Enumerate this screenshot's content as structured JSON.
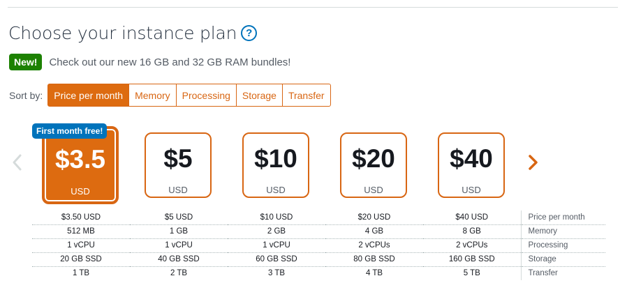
{
  "header": {
    "title": "Choose your instance plan",
    "help_icon": "?"
  },
  "promo": {
    "badge": "New!",
    "text": "Check out our new 16 GB and 32 GB RAM bundles!"
  },
  "sort": {
    "label": "Sort by:",
    "options": [
      "Price per month",
      "Memory",
      "Processing",
      "Storage",
      "Transfer"
    ],
    "active": "Price per month"
  },
  "carousel": {
    "prev_icon": "chevron-left",
    "next_icon": "chevron-right"
  },
  "plans": [
    {
      "price": "$3.5",
      "currency": "USD",
      "selected": true,
      "badge": "First month free!"
    },
    {
      "price": "$5",
      "currency": "USD",
      "selected": false
    },
    {
      "price": "$10",
      "currency": "USD",
      "selected": false
    },
    {
      "price": "$20",
      "currency": "USD",
      "selected": false
    },
    {
      "price": "$40",
      "currency": "USD",
      "selected": false
    }
  ],
  "specs": {
    "rows": [
      {
        "label": "Price per month",
        "values": [
          "$3.50 USD",
          "$5 USD",
          "$10 USD",
          "$20 USD",
          "$40 USD"
        ]
      },
      {
        "label": "Memory",
        "values": [
          "512 MB",
          "1 GB",
          "2 GB",
          "4 GB",
          "8 GB"
        ]
      },
      {
        "label": "Processing",
        "values": [
          "1 vCPU",
          "1 vCPU",
          "1 vCPU",
          "2 vCPUs",
          "2 vCPUs"
        ]
      },
      {
        "label": "Storage",
        "values": [
          "20 GB SSD",
          "40 GB SSD",
          "60 GB SSD",
          "80 GB SSD",
          "160 GB SSD"
        ]
      },
      {
        "label": "Transfer",
        "values": [
          "1 TB",
          "2 TB",
          "3 TB",
          "4 TB",
          "5 TB"
        ]
      }
    ]
  },
  "colors": {
    "accent": "#dd6b10",
    "accent_border": "#d86613",
    "badge_green": "#1d8102",
    "badge_blue": "#0073bb",
    "link": "#0073bb"
  }
}
